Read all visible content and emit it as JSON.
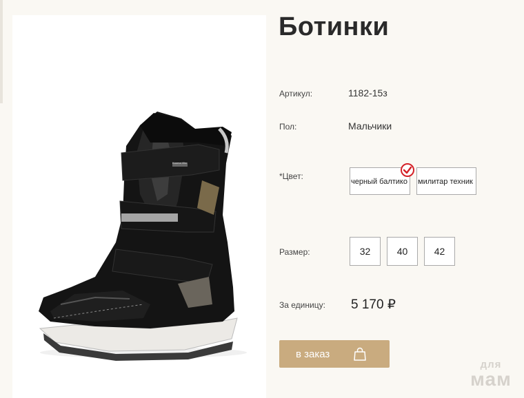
{
  "product": {
    "title": "Ботинки",
    "image_alt": "black-winter-boot-photo",
    "boot_badge": "Kuoma Vita"
  },
  "specs": {
    "article_label": "Артикул:",
    "article_value": "1182-15з",
    "gender_label": "Пол:",
    "gender_value": "Мальчики"
  },
  "color": {
    "label": "*Цвет:",
    "options": [
      "черный балтико",
      "милитар техник"
    ],
    "selected": "черный балтико"
  },
  "size": {
    "label": "Размер:",
    "options": [
      "32",
      "40",
      "42"
    ]
  },
  "price": {
    "label": "За единицу:",
    "value": "5 170 ₽"
  },
  "order": {
    "button_label": "в заказ",
    "icon": "shopping-bag-icon"
  },
  "watermark": {
    "line1": "для",
    "line2": "мам"
  },
  "colors": {
    "background": "#faf8f3",
    "accent": "#c9ab7f",
    "check": "#d42027"
  }
}
